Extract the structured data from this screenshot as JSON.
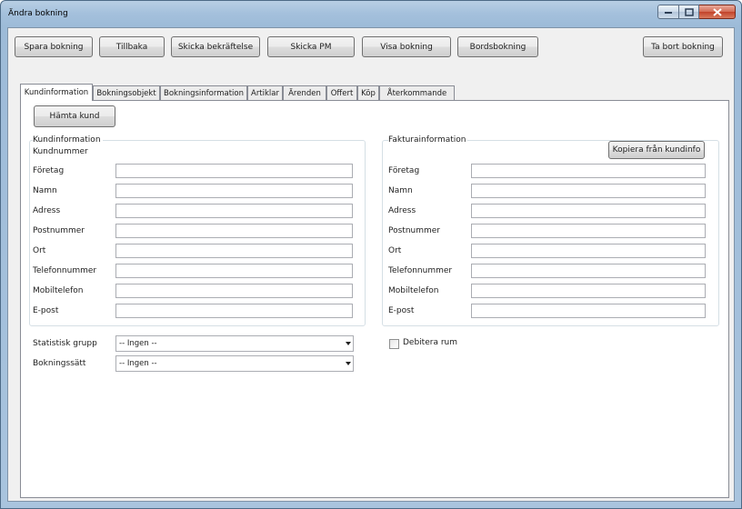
{
  "window": {
    "title": "Ändra bokning"
  },
  "toolbar": {
    "save": "Spara bokning",
    "back": "Tillbaka",
    "send_confirmation": "Skicka bekräftelse",
    "send_pm": "Skicka PM",
    "show_booking": "Visa bokning",
    "table_booking": "Bordsbokning",
    "delete_booking": "Ta bort bokning"
  },
  "tabs": [
    {
      "label": "Kundinformation",
      "active": true
    },
    {
      "label": "Bokningsobjekt"
    },
    {
      "label": "Bokningsinformation"
    },
    {
      "label": "Artiklar"
    },
    {
      "label": "Ärenden"
    },
    {
      "label": "Offert"
    },
    {
      "label": "Köp"
    },
    {
      "label": "Återkommande"
    }
  ],
  "customer": {
    "fetch_button": "Hämta kund",
    "group_title": "Kundinformation",
    "customer_number_label": "Kundnummer",
    "fields": [
      {
        "label": "Företag",
        "value": ""
      },
      {
        "label": "Namn",
        "value": ""
      },
      {
        "label": "Adress",
        "value": ""
      },
      {
        "label": "Postnummer",
        "value": ""
      },
      {
        "label": "Ort",
        "value": ""
      },
      {
        "label": "Telefonnummer",
        "value": ""
      },
      {
        "label": "Mobiltelefon",
        "value": ""
      },
      {
        "label": "E-post",
        "value": ""
      }
    ]
  },
  "invoice": {
    "group_title": "Fakturainformation",
    "copy_button": "Kopiera från kundinfo",
    "fields": [
      {
        "label": "Företag",
        "value": ""
      },
      {
        "label": "Namn",
        "value": ""
      },
      {
        "label": "Adress",
        "value": ""
      },
      {
        "label": "Postnummer",
        "value": ""
      },
      {
        "label": "Ort",
        "value": ""
      },
      {
        "label": "Telefonnummer",
        "value": ""
      },
      {
        "label": "Mobiltelefon",
        "value": ""
      },
      {
        "label": "E-post",
        "value": ""
      }
    ]
  },
  "extra": {
    "stat_group_label": "Statistisk grupp",
    "stat_group_value": "-- Ingen --",
    "booking_method_label": "Bokningssätt",
    "booking_method_value": "-- Ingen --",
    "debit_room_label": "Debitera rum",
    "debit_room_checked": false
  }
}
